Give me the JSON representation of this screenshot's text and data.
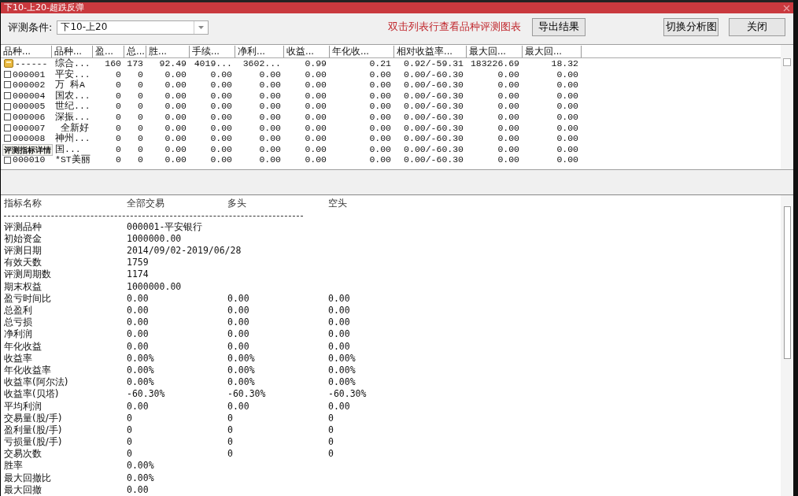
{
  "window": {
    "title": "下10-上20-超跌反弹"
  },
  "toolbar": {
    "condition_label": "评测条件:",
    "condition_value": "下10-上20",
    "hint": "双击列表行查看品种评测图表",
    "buttons": [
      "导出结果",
      "切换分析图",
      "关闭"
    ]
  },
  "table": {
    "columns": [
      "品种...",
      "品种...",
      "盈...",
      "总...",
      "胜...",
      "手续...",
      "净利...",
      "收益...",
      "年化收...",
      "相对收益率...",
      "最大回...",
      "最大回..."
    ],
    "rows": [
      {
        "kind": "summary",
        "cells": [
          "------",
          "综合...",
          "160",
          "173",
          "92.49",
          "4019...",
          "3602...",
          "0.99",
          "0.21",
          "0.92/-59.31",
          "183226.69",
          "18.32"
        ]
      },
      {
        "kind": "item",
        "checked": false,
        "cells": [
          "000001",
          "平安...",
          "0",
          "0",
          "0.00",
          "0.00",
          "0.00",
          "0.00",
          "0.00",
          "0.00/-60.30",
          "0.00",
          "0.00"
        ]
      },
      {
        "kind": "item",
        "checked": false,
        "cells": [
          "000002",
          "万 科A",
          "0",
          "0",
          "0.00",
          "0.00",
          "0.00",
          "0.00",
          "0.00",
          "0.00/-60.30",
          "0.00",
          "0.00"
        ]
      },
      {
        "kind": "item",
        "checked": false,
        "cells": [
          "000004",
          "国农...",
          "0",
          "0",
          "0.00",
          "0.00",
          "0.00",
          "0.00",
          "0.00",
          "0.00/-60.30",
          "0.00",
          "0.00"
        ]
      },
      {
        "kind": "item",
        "checked": false,
        "cells": [
          "000005",
          "世纪...",
          "0",
          "0",
          "0.00",
          "0.00",
          "0.00",
          "0.00",
          "0.00",
          "0.00/-60.30",
          "0.00",
          "0.00"
        ]
      },
      {
        "kind": "item",
        "checked": false,
        "cells": [
          "000006",
          "深振...",
          "0",
          "0",
          "0.00",
          "0.00",
          "0.00",
          "0.00",
          "0.00",
          "0.00/-60.30",
          "0.00",
          "0.00"
        ]
      },
      {
        "kind": "item",
        "checked": false,
        "cells": [
          "000007",
          " 全新好",
          "0",
          "0",
          "0.00",
          "0.00",
          "0.00",
          "0.00",
          "0.00",
          "0.00/-60.30",
          "0.00",
          "0.00"
        ]
      },
      {
        "kind": "item",
        "checked": false,
        "cells": [
          "000008",
          "神州...",
          "0",
          "0",
          "0.00",
          "0.00",
          "0.00",
          "0.00",
          "0.00",
          "0.00/-60.30",
          "0.00",
          "0.00"
        ]
      },
      {
        "kind": "covered",
        "cells": [
          null,
          "国...",
          "0",
          "0",
          "0.00",
          "0.00",
          "0.00",
          "0.00",
          "0.00",
          "0.00/-60.30",
          "0.00",
          "0.00"
        ]
      },
      {
        "kind": "item",
        "checked": false,
        "cells": [
          "000010",
          "*ST美丽",
          "0",
          "0",
          "0.00",
          "0.00",
          "0.00",
          "0.00",
          "0.00",
          "0.00/-60.30",
          "0.00",
          "0.00"
        ]
      }
    ],
    "tooltip": "评测指标详情"
  },
  "details": {
    "columns": [
      "指标名称",
      "全部交易",
      "多头",
      "空头"
    ],
    "rows": [
      {
        "name": "评测品种",
        "values": [
          "000001-平安银行"
        ]
      },
      {
        "name": "初始资金",
        "values": [
          "1000000.00"
        ]
      },
      {
        "name": "评测日期",
        "values": [
          "2014/09/02-2019/06/28"
        ]
      },
      {
        "name": "有效天数",
        "values": [
          "1759"
        ]
      },
      {
        "name": "评测周期数",
        "values": [
          "1174"
        ]
      },
      {
        "name": "期末权益",
        "values": [
          "1000000.00"
        ]
      },
      {
        "name": "盈亏时间比",
        "values": [
          "0.00",
          "0.00",
          "0.00"
        ]
      },
      {
        "name": "总盈利",
        "values": [
          "0.00",
          "0.00",
          "0.00"
        ]
      },
      {
        "name": "总亏损",
        "values": [
          "0.00",
          "0.00",
          "0.00"
        ]
      },
      {
        "name": "净利润",
        "values": [
          "0.00",
          "0.00",
          "0.00"
        ]
      },
      {
        "name": "年化收益",
        "values": [
          "0.00",
          "0.00",
          "0.00"
        ]
      },
      {
        "name": "收益率",
        "values": [
          "0.00%",
          "0.00%",
          "0.00%"
        ]
      },
      {
        "name": "年化收益率",
        "values": [
          "0.00%",
          "0.00%",
          "0.00%"
        ]
      },
      {
        "name": "收益率(阿尔法)",
        "values": [
          "0.00%",
          "0.00%",
          "0.00%"
        ]
      },
      {
        "name": "收益率(贝塔)",
        "values": [
          "-60.30%",
          "-60.30%",
          "-60.30%"
        ]
      },
      {
        "name": "平均利润",
        "values": [
          "0.00",
          "0.00",
          "0.00"
        ]
      },
      {
        "name": "交易量(股/手)",
        "values": [
          "0",
          "0",
          "0"
        ]
      },
      {
        "name": "盈利量(股/手)",
        "values": [
          "0",
          "0",
          "0"
        ]
      },
      {
        "name": "亏损量(股/手)",
        "values": [
          "0",
          "0",
          "0"
        ]
      },
      {
        "name": "交易次数",
        "values": [
          "0",
          "0",
          "0"
        ]
      },
      {
        "name": "胜率",
        "values": [
          "0.00%"
        ]
      },
      {
        "name": "最大回撤比",
        "values": [
          "0.00%"
        ]
      },
      {
        "name": "最大回撤",
        "values": [
          "0.00"
        ]
      }
    ]
  }
}
